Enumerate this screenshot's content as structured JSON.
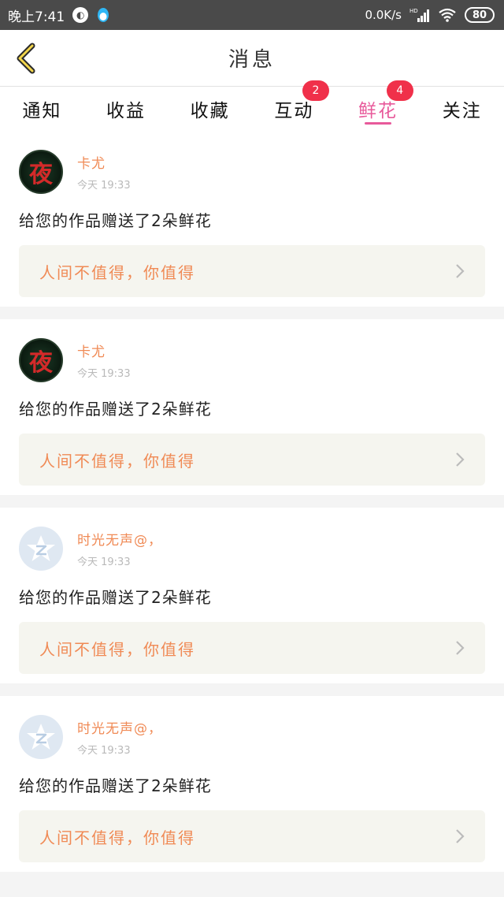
{
  "status_bar": {
    "time": "晚上7:41",
    "net_speed": "0.0K/s",
    "signal_label": "HD",
    "battery": "80"
  },
  "header": {
    "title": "消息",
    "back_icon": "chevron-left-icon"
  },
  "tabs": [
    {
      "label": "通知",
      "badge": ""
    },
    {
      "label": "收益",
      "badge": ""
    },
    {
      "label": "收藏",
      "badge": ""
    },
    {
      "label": "互动",
      "badge": "2"
    },
    {
      "label": "鲜花",
      "badge": "4",
      "active": true
    },
    {
      "label": "关注",
      "badge": ""
    }
  ],
  "colors": {
    "accent": "#e85a9b",
    "badge": "#f0304a",
    "username": "#f08a55"
  },
  "messages": [
    {
      "username": "卡尤",
      "time": "今天 19:33",
      "text": "给您的作品赠送了2朵鲜花",
      "work_title": "人间不值得，你值得",
      "avatar": "night-character-avatar"
    },
    {
      "username": "卡尤",
      "time": "今天 19:33",
      "text": "给您的作品赠送了2朵鲜花",
      "work_title": "人间不值得，你值得",
      "avatar": "night-character-avatar"
    },
    {
      "username": "时光无声@，",
      "time": "今天 19:33",
      "text": "给您的作品赠送了2朵鲜花",
      "work_title": "人间不值得，你值得",
      "avatar": "qzone-star-avatar"
    },
    {
      "username": "时光无声@，",
      "time": "今天 19:33",
      "text": "给您的作品赠送了2朵鲜花",
      "work_title": "人间不值得，你值得",
      "avatar": "qzone-star-avatar"
    }
  ]
}
